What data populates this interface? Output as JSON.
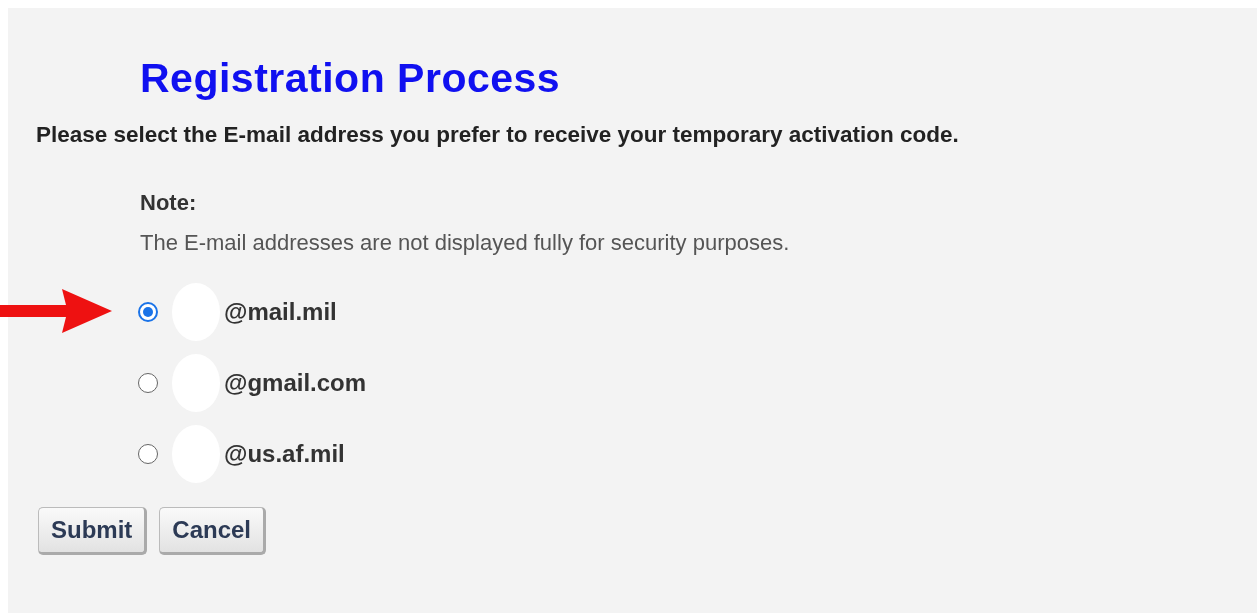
{
  "title": "Registration Process",
  "instruction": "Please select the E-mail address you prefer to receive your temporary activation code.",
  "note": {
    "label": "Note:",
    "text": "The E-mail addresses are not displayed fully for security purposes."
  },
  "options": [
    {
      "label": "@mail.mil",
      "selected": true
    },
    {
      "label": "@gmail.com",
      "selected": false
    },
    {
      "label": "@us.af.mil",
      "selected": false
    }
  ],
  "buttons": [
    "Submit",
    "Cancel"
  ]
}
